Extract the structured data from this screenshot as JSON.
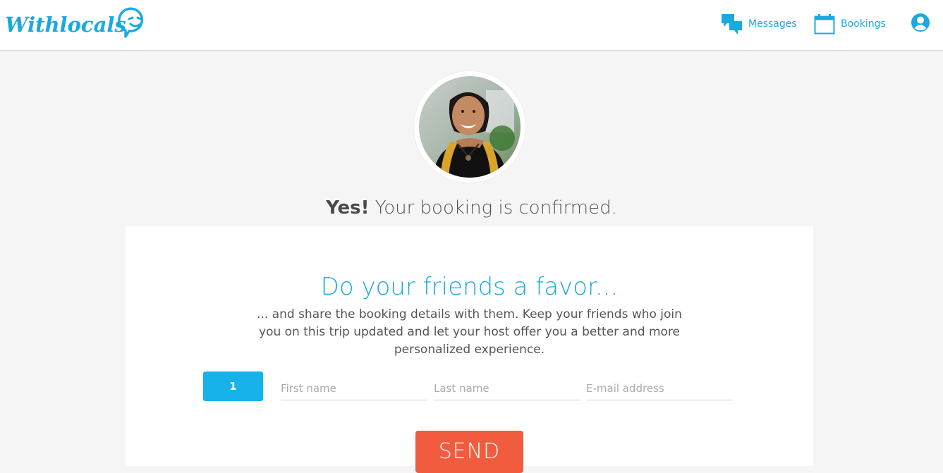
{
  "header": {
    "logo_text": "Withlocals",
    "nav": [
      {
        "label": "Messages",
        "icon": "messages-icon"
      },
      {
        "label": "Bookings",
        "icon": "calendar-icon"
      }
    ],
    "account_icon": "user-account-icon"
  },
  "confirmation": {
    "bold": "Yes!",
    "text": " Your booking is confirmed."
  },
  "share": {
    "title": "Do your friends a favor...",
    "description": "... and share the booking details with them. Keep your friends who join you on this trip updated and let your host offer you a better and more personalized experience.",
    "row_number": "1",
    "first_name_placeholder": "First name",
    "last_name_placeholder": "Last name",
    "email_placeholder": "E-mail address",
    "send_label": "SEND"
  },
  "colors": {
    "brand_blue": "#1aa9df",
    "row_badge": "#17b2ea",
    "send_button": "#f25c3e",
    "page_bg": "#f5f5f5"
  }
}
